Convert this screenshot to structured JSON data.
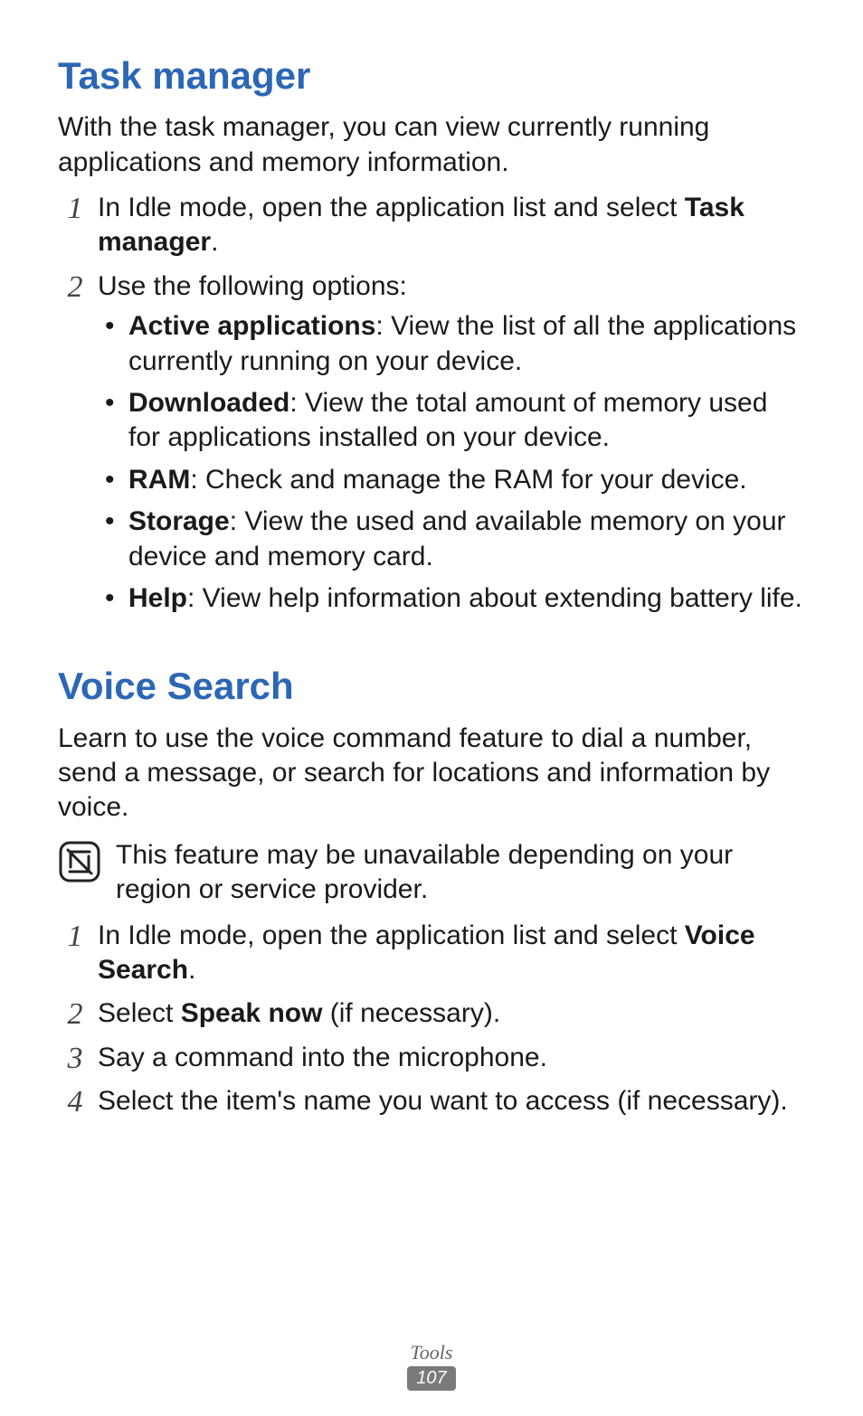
{
  "section1": {
    "title": "Task manager",
    "intro": "With the task manager, you can view currently running applications and memory information.",
    "step1_prefix": "In Idle mode, open the application list and select ",
    "step1_bold": "Task manager",
    "step1_suffix": ".",
    "step2_intro": "Use the following options:",
    "bullets": [
      {
        "bold": "Active applications",
        "rest": ": View the list of all the applications currently running on your device."
      },
      {
        "bold": "Downloaded",
        "rest": ": View the total amount of memory used for applications installed on your device."
      },
      {
        "bold": "RAM",
        "rest": ": Check and manage the RAM for your device."
      },
      {
        "bold": "Storage",
        "rest": ": View the used and available memory on your device and memory card."
      },
      {
        "bold": "Help",
        "rest": ": View help information about extending battery life."
      }
    ]
  },
  "section2": {
    "title": "Voice Search",
    "intro": "Learn to use the voice command feature to dial a number, send a message, or search for locations and information by voice.",
    "note": "This feature may be unavailable depending on your region or service provider.",
    "step1_prefix": "In Idle mode, open the application list and select ",
    "step1_bold": "Voice Search",
    "step1_suffix": ".",
    "step2_prefix": "Select ",
    "step2_bold": "Speak now",
    "step2_suffix": " (if necessary).",
    "step3": "Say a command into the microphone.",
    "step4": "Select the item's name you want to access (if necessary)."
  },
  "step_numbers": {
    "n1": "1",
    "n2": "2",
    "n3": "3",
    "n4": "4"
  },
  "footer": {
    "category": "Tools",
    "page": "107"
  }
}
